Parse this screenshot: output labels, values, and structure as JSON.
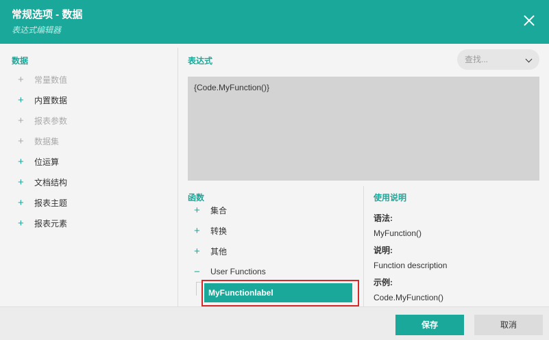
{
  "header": {
    "title": "常规选项 - 数据",
    "subtitle": "表达式编辑器"
  },
  "left_panel": {
    "title": "数据",
    "items": [
      {
        "label": "常量数值",
        "enabled": false
      },
      {
        "label": "内置数据",
        "enabled": true
      },
      {
        "label": "报表参数",
        "enabled": false
      },
      {
        "label": "数据集",
        "enabled": false
      },
      {
        "label": "位运算",
        "enabled": true
      },
      {
        "label": "文档结构",
        "enabled": true
      },
      {
        "label": "报表主题",
        "enabled": true
      },
      {
        "label": "报表元素",
        "enabled": true
      }
    ]
  },
  "expression": {
    "title": "表达式",
    "value": "{Code.MyFunction()}",
    "search_placeholder": "查找..."
  },
  "functions": {
    "title": "函数",
    "items": [
      {
        "label": "集合",
        "expanded": false
      },
      {
        "label": "转换",
        "expanded": false
      },
      {
        "label": "其他",
        "expanded": false
      },
      {
        "label": "User Functions",
        "expanded": true
      }
    ],
    "selected": "MyFunctionlabel"
  },
  "usage": {
    "title": "使用说明",
    "syntax_label": "语法:",
    "syntax_value": "MyFunction()",
    "desc_label": "说明:",
    "desc_value": "Function description",
    "example_label": "示例:",
    "example_value": "Code.MyFunction()"
  },
  "footer": {
    "save_label": "保存",
    "cancel_label": "取消"
  },
  "colors": {
    "accent": "#1aa89a",
    "highlight_border": "#d62828"
  },
  "icons": {
    "close": "close-icon",
    "search_dropdown": "chevron-down-icon",
    "expand": "plus-icon",
    "collapse": "minus-icon"
  }
}
